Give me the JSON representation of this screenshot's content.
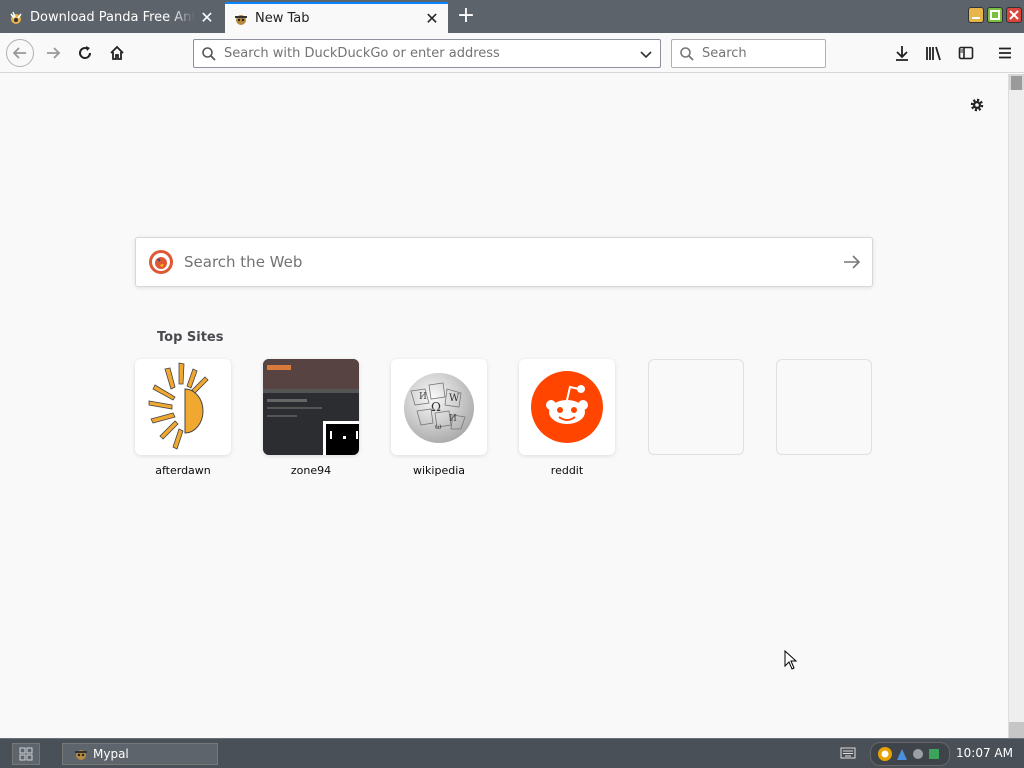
{
  "tabs": [
    {
      "title": "Download Panda Free Antivirus",
      "active": false
    },
    {
      "title": "New Tab",
      "active": true
    }
  ],
  "urlbar": {
    "placeholder": "Search with DuckDuckGo or enter address",
    "value": ""
  },
  "searchbar": {
    "placeholder": "Search",
    "value": ""
  },
  "content": {
    "web_search_placeholder": "Search the Web",
    "top_sites_heading": "Top Sites",
    "top_sites": [
      {
        "label": "afterdawn"
      },
      {
        "label": "zone94"
      },
      {
        "label": "wikipedia"
      },
      {
        "label": "reddit"
      },
      {
        "label": ""
      },
      {
        "label": ""
      }
    ]
  },
  "taskbar": {
    "task_label": "Mypal",
    "clock": "10:07 AM"
  },
  "colors": {
    "accent": "#0a84ff",
    "reddit": "#ff4500",
    "afterdawn": "#f0a830",
    "tabstrip": "#5d636b",
    "taskbar": "#4a5057"
  }
}
